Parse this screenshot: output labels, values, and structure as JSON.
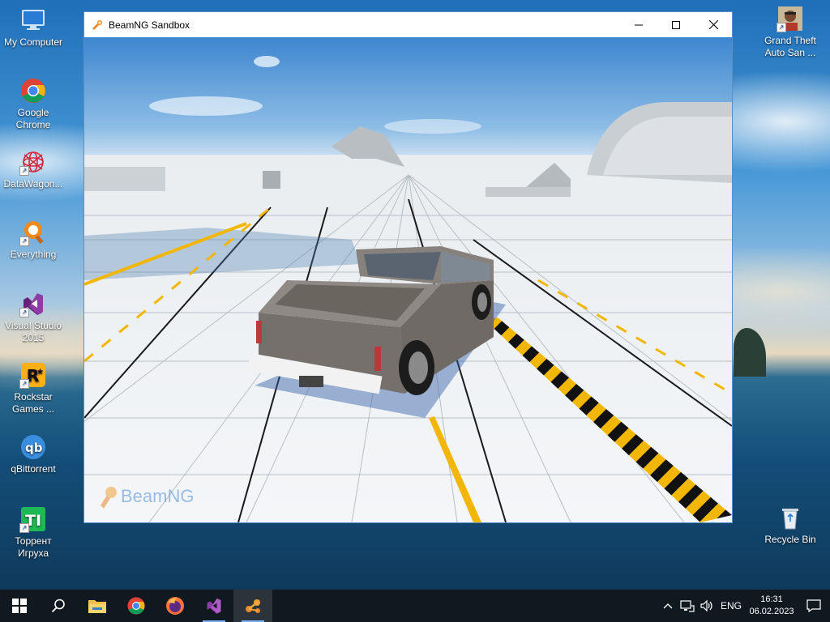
{
  "desktop": {
    "icons_left": [
      {
        "label": "My Computer",
        "icon": "computer-icon"
      },
      {
        "label": "Google Chrome",
        "icon": "chrome-icon"
      },
      {
        "label": "DataWagon...",
        "icon": "datawagon-icon"
      },
      {
        "label": "Everything",
        "icon": "everything-icon"
      },
      {
        "label": "Visual Studio 2015",
        "icon": "visual-studio-icon"
      },
      {
        "label": "Rockstar Games ...",
        "icon": "rockstar-icon"
      },
      {
        "label": "qBittorrent",
        "icon": "qbittorrent-icon"
      },
      {
        "label": "Торрент Игруха",
        "icon": "torrent-igruha-icon"
      }
    ],
    "icons_right": [
      {
        "label": "Grand Theft Auto San ...",
        "icon": "gta-icon"
      },
      {
        "label": "Recycle Bin",
        "icon": "recycle-bin-icon"
      }
    ]
  },
  "window": {
    "title": "BeamNG Sandbox",
    "minimize_glyph": "—",
    "maximize_glyph": "☐",
    "close_glyph": "✕",
    "watermark": "BeamNG"
  },
  "taskbar": {
    "apps": [
      "start-icon",
      "search-icon",
      "file-explorer-icon",
      "chrome-icon",
      "firefox-icon",
      "visual-studio-icon",
      "beamng-icon"
    ],
    "language": "ENG",
    "time": "16:31",
    "date": "06.02.2023"
  },
  "colors": {
    "taskbar_bg": "#101820",
    "window_border": "#5a8fc8",
    "accent": "#77b0ee"
  }
}
